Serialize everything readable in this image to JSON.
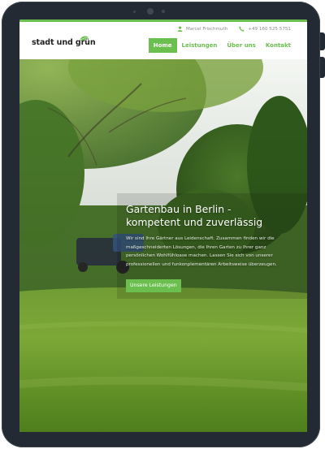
{
  "topbar": {
    "contact_name": "Marcel Frischmuth",
    "phone": "+49 160 525 5751"
  },
  "logo": {
    "text": "stadt und grün"
  },
  "nav": {
    "items": [
      {
        "label": "Home",
        "active": true
      },
      {
        "label": "Leistungen",
        "active": false
      },
      {
        "label": "Über uns",
        "active": false
      },
      {
        "label": "Kontakt",
        "active": false
      }
    ]
  },
  "hero": {
    "title": "Gartenbau in Berlin - kompetent und zuverlässig",
    "text": "Wir sind Ihre Gärtner aus Leidenschaft. Zusammen finden wir die maßgeschneiderten Lösungen, die Ihren Garten zu Ihrer ganz persönlichen Wohlfühloase machen. Lassen Sie sich von unserer professionellen und funkonplementären Arbeitsweise überzeugen.",
    "button_label": "Unsere Leistungen"
  },
  "colors": {
    "brand_green": "#6bbf4e",
    "device_frame": "#232a33"
  },
  "icons": {
    "contact": "user-icon",
    "phone": "phone-icon",
    "logo": "leaf-icon"
  }
}
